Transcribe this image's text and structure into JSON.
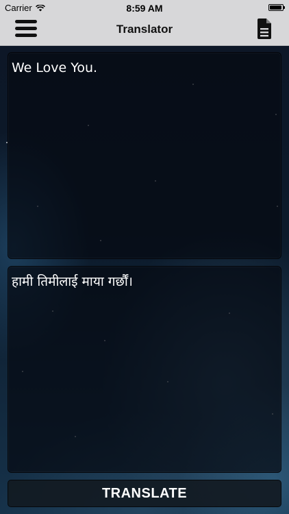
{
  "status_bar": {
    "carrier": "Carrier",
    "time": "8:59 AM"
  },
  "nav": {
    "title": "Translator",
    "left_icon": "menu-icon",
    "right_icon": "document-icon"
  },
  "input_panel": {
    "text": "We Love You."
  },
  "output_panel": {
    "text": "हामी तिमीलाई माया गर्छौं।"
  },
  "actions": {
    "translate_label": "TRANSLATE"
  }
}
